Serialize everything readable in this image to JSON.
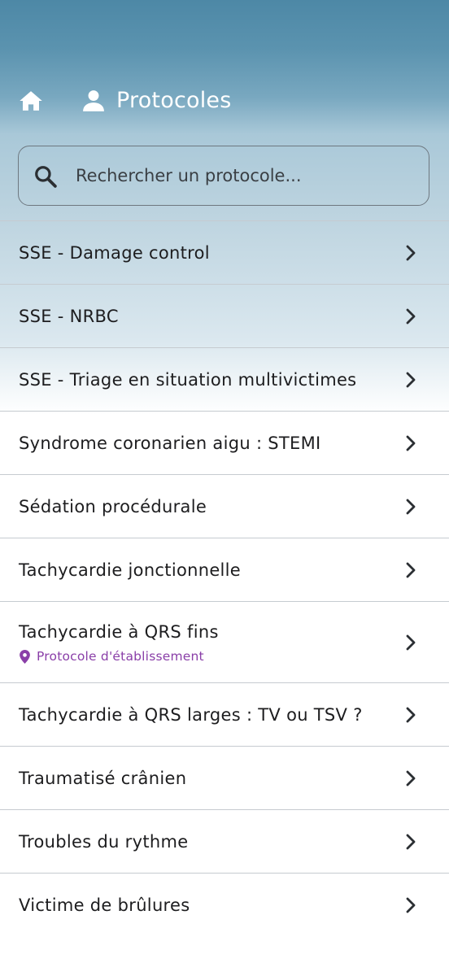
{
  "header": {
    "home_icon": "home-icon",
    "user_icon": "person-icon",
    "title": "Protocoles",
    "title_color": "#ffffff"
  },
  "search": {
    "placeholder": "Rechercher un protocole...",
    "value": "",
    "icon": "search-icon"
  },
  "list": {
    "items": [
      {
        "label": "SSE - Damage control"
      },
      {
        "label": "SSE - NRBC"
      },
      {
        "label": "SSE - Triage en situation multivictimes"
      },
      {
        "label": "Syndrome coronarien aigu : STEMI"
      },
      {
        "label": "Sédation procédurale"
      },
      {
        "label": "Tachycardie jonctionnelle"
      },
      {
        "label": "Tachycardie à QRS fins",
        "subtitle": "Protocole d'établissement",
        "subtitle_icon": "location-pin-icon",
        "subtitle_color": "#8a3fa8"
      },
      {
        "label": "Tachycardie à QRS larges : TV ou TSV ?"
      },
      {
        "label": "Traumatisé crânien"
      },
      {
        "label": "Troubles du rythme"
      },
      {
        "label": "Victime de brûlures"
      }
    ],
    "chevron_icon": "chevron-right-icon"
  },
  "colors": {
    "header_gradient_top": "#4d88a6",
    "accent_purple": "#8a3fa8",
    "divider": "#c6cbd0",
    "text": "#1d1d1f"
  }
}
